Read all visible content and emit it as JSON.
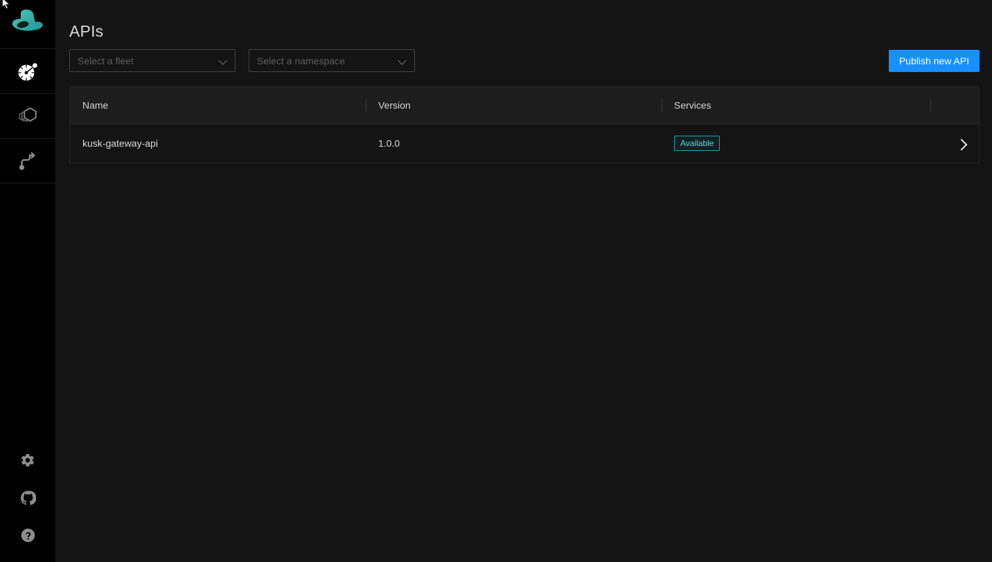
{
  "app": {
    "title": "APIs",
    "brand_logo": "top-hat-logo",
    "accent_blue": "#1890ff",
    "accent_teal": "#13a8a8",
    "background": "#141414",
    "sidebar_background": "#000000"
  },
  "sidebar": {
    "logo": {
      "name": "kusk-top-hat-logo",
      "color": "#3cb4ad"
    },
    "items": [
      {
        "icon": "fleet-gauge-icon",
        "label": "Fleets"
      },
      {
        "icon": "hexagons-apis-icon",
        "label": "APIs"
      },
      {
        "icon": "route-path-icon",
        "label": "Routes"
      }
    ],
    "bottom_items": [
      {
        "icon": "gear-icon",
        "label": "Settings"
      },
      {
        "icon": "github-icon",
        "label": "GitHub"
      },
      {
        "icon": "help-question-icon",
        "label": "Help"
      }
    ]
  },
  "toolbar": {
    "fleet_select": {
      "placeholder": "Select a fleet",
      "value": ""
    },
    "namespace_select": {
      "placeholder": "Select a namespace",
      "value": ""
    },
    "publish_label": "Publish new API"
  },
  "table": {
    "columns": [
      "Name",
      "Version",
      "Services"
    ],
    "rows": [
      {
        "name": "kusk-gateway-api",
        "version": "1.0.0",
        "service_status": "Available",
        "chevron": "chevron-right-icon"
      }
    ]
  }
}
